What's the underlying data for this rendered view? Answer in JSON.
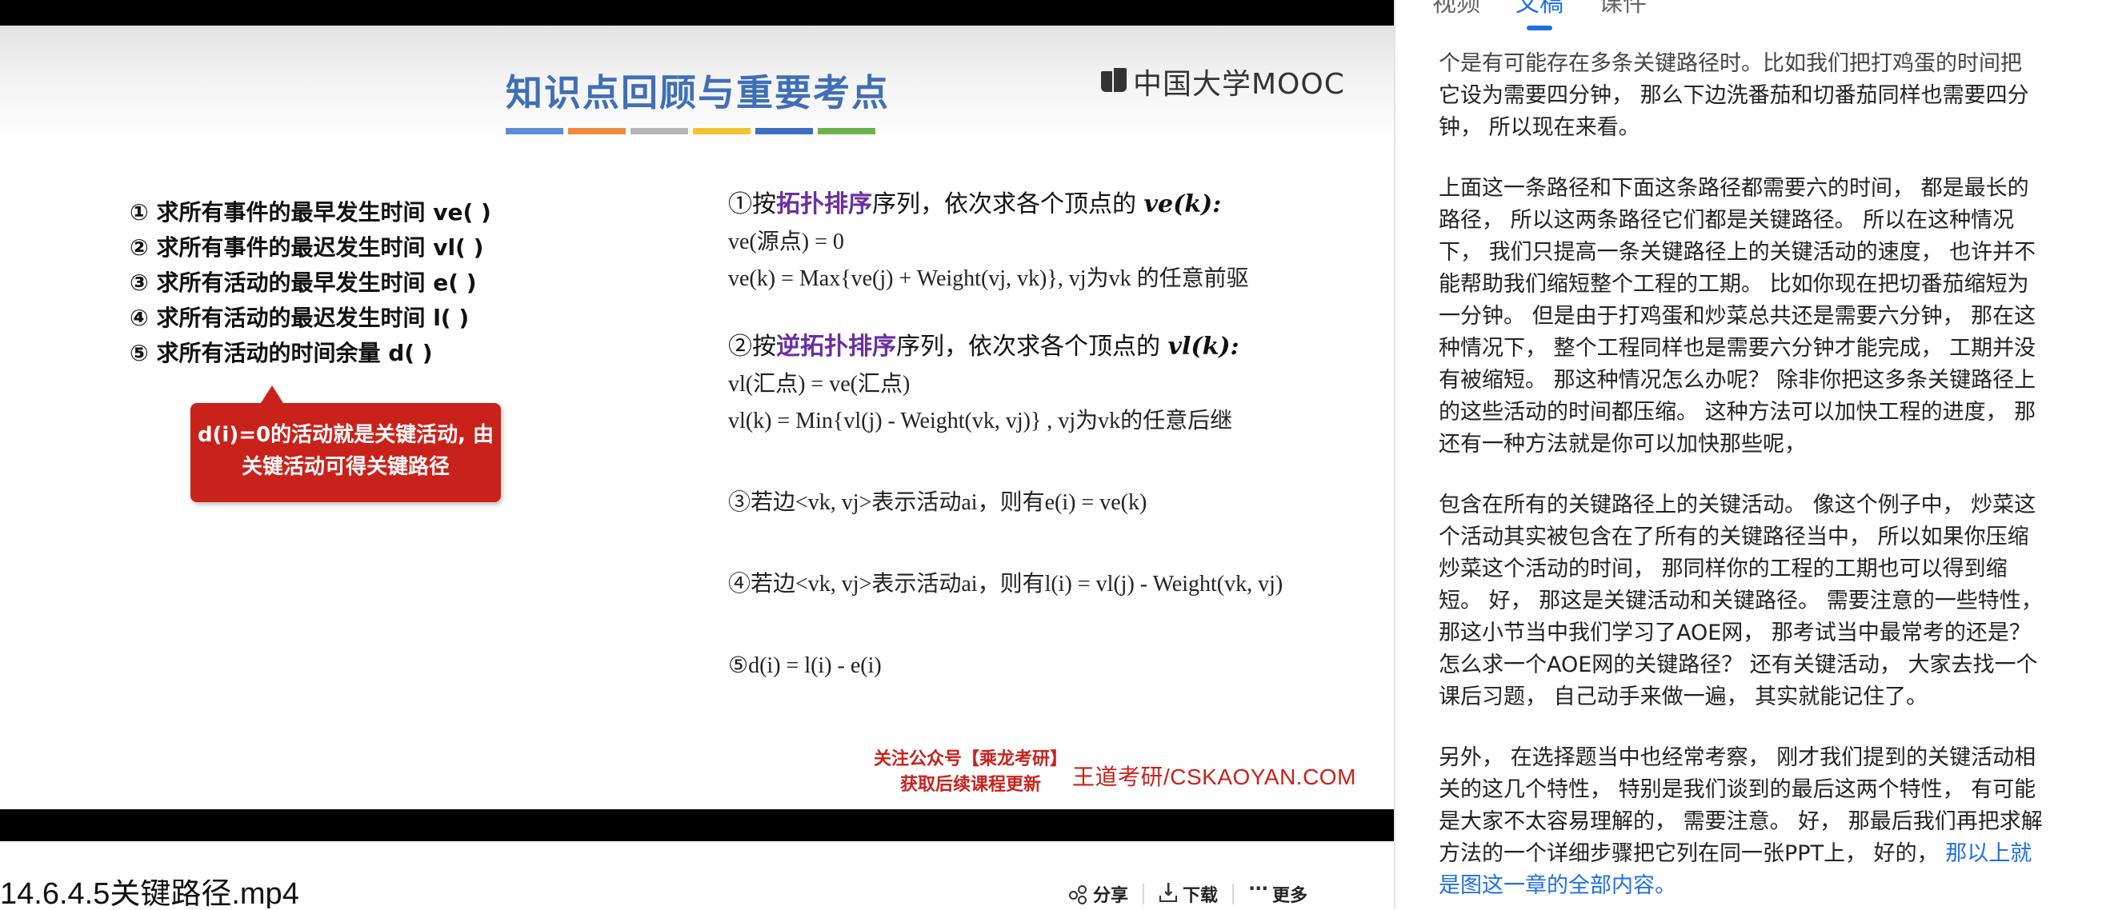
{
  "slide": {
    "title": "知识点回顾与重要考点",
    "title_bar_colors": [
      "#5b8fd6",
      "#f08a3c",
      "#b5b5b5",
      "#f4c430",
      "#3c6fbf",
      "#6db34a"
    ],
    "logo_text": "中国大学MOOC",
    "left_list": [
      "① 求所有事件的最早发生时间 ve( )",
      "② 求所有事件的最迟发生时间 vl( )",
      "③  求所有活动的最早发生时间 e( )",
      "④  求所有活动的最迟发生时间 l( )",
      "⑤      求所有活动的时间余量 d( )"
    ],
    "callout": [
      "d(i)=0的活动就是关键活动, 由",
      "关键活动可得关键路径"
    ],
    "steps": {
      "s1_prefix": "①按",
      "s1_highlight": "拓扑排序",
      "s1_suffix": "序列，依次求各个顶点的 ",
      "s1_var": "ve(k):",
      "s1_f1": "ve(源点) = 0",
      "s1_f2": "ve(k) = Max{ve(j) + Weight(vj, vk)},   vj为vk 的任意前驱",
      "s2_prefix": "②按",
      "s2_highlight": "逆拓扑排序",
      "s2_suffix": "序列，依次求各个顶点的 ",
      "s2_var": "vl(k):",
      "s2_f1": "vl(汇点) = ve(汇点)",
      "s2_f2": "vl(k) = Min{vl(j) - Weight(vk, vj)} , vj为vk的任意后继",
      "s3": "③若边<vk, vj>表示活动ai，则有e(i) = ve(k)",
      "s4": "④若边<vk, vj>表示活动ai，则有l(i) = vl(j) - Weight(vk, vj)",
      "s5": "⑤d(i) = l(i) - e(i)"
    },
    "promo": [
      "关注公众号【乘龙考研】",
      "获取后续课程更新"
    ],
    "site": "王道考研/CSKAOYAN.COM"
  },
  "video": {
    "filename": "14.6.4.5关键路径.mp4"
  },
  "actions": {
    "share": "分享",
    "download": "下载",
    "more": "更多"
  },
  "panel": {
    "tabs": [
      "视频",
      "文稿",
      "课件"
    ],
    "active_tab": "文稿",
    "transcript_lines": [
      {
        "text": "个是有可能存在多条关键路径时。比如我们把打鸡蛋的时间把",
        "type": "cut"
      },
      {
        "text": "它设为需要四分钟， 那么下边洗番茄和切番茄同样也需要四分"
      },
      {
        "text": "钟， 所以现在来看。"
      },
      {
        "gap": true
      },
      {
        "text": "上面这一条路径和下面这条路径都需要六的时间， 都是最长的"
      },
      {
        "text": "路径， 所以这两条路径它们都是关键路径。 所以在这种情况"
      },
      {
        "text": "下， 我们只提高一条关键路径上的关键活动的速度， 也许并不"
      },
      {
        "text": "能帮助我们缩短整个工程的工期。 比如你现在把切番茄缩短为"
      },
      {
        "text": "一分钟。 但是由于打鸡蛋和炒菜总共还是需要六分钟， 那在这"
      },
      {
        "text": "种情况下， 整个工程同样也是需要六分钟才能完成， 工期并没"
      },
      {
        "text": "有被缩短。 那这种情况怎么办呢？ 除非你把这多条关键路径上"
      },
      {
        "text": "的这些活动的时间都压缩。 这种方法可以加快工程的进度， 那"
      },
      {
        "text": "还有一种方法就是你可以加快那些呢，"
      },
      {
        "gap": true
      },
      {
        "text": "包含在所有的关键路径上的关键活动。 像这个例子中， 炒菜这"
      },
      {
        "text": "个活动其实被包含在了所有的关键路径当中， 所以如果你压缩"
      },
      {
        "text": "炒菜这个活动的时间， 那同样你的工程的工期也可以得到缩"
      },
      {
        "text": "短。 好， 那这是关键活动和关键路径。 需要注意的一些特性，"
      },
      {
        "text": " 那这小节当中我们学习了AOE网， 那考试当中最常考的还是？"
      },
      {
        "text": " 怎么求一个AOE网的关键路径？ 还有关键活动， 大家去找一个"
      },
      {
        "text": "课后习题， 自己动手来做一遍， 其实就能记住了。"
      },
      {
        "gap": true
      },
      {
        "text": "另外， 在选择题当中也经常考察， 刚才我们提到的关键活动相"
      },
      {
        "text": "关的这几个特性， 特别是我们谈到的最后这两个特性， 有可能"
      },
      {
        "text": "是大家不太容易理解的， 需要注意。 好， 那最后我们再把求解"
      },
      {
        "text": "方法的一个详细步骤把它列在同一张PPT上， 好的， ",
        "link": "那以上就"
      },
      {
        "text": "",
        "link": "是图这一章的全部内容。"
      }
    ]
  }
}
